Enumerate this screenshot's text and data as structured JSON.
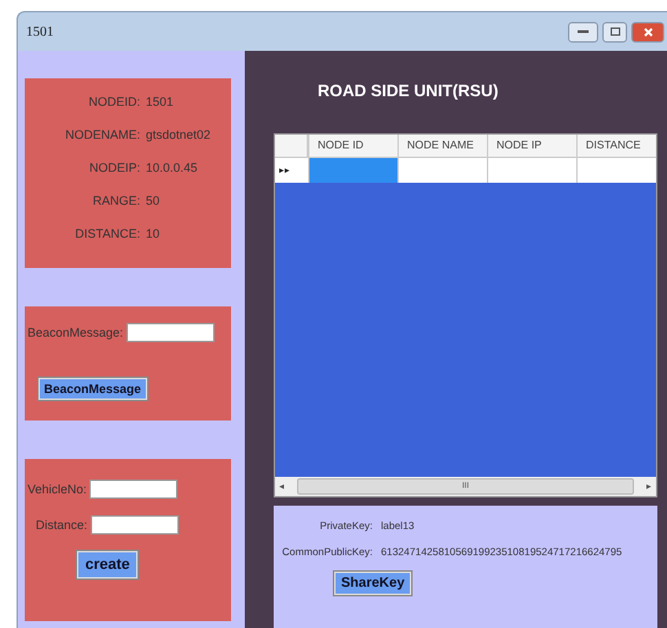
{
  "window": {
    "title": "1501"
  },
  "node_info": [
    {
      "label": "NODEID:",
      "value": "1501"
    },
    {
      "label": "NODENAME:",
      "value": "gtsdotnet02"
    },
    {
      "label": "NODEIP:",
      "value": "10.0.0.45"
    },
    {
      "label": "RANGE:",
      "value": "50"
    },
    {
      "label": "DISTANCE:",
      "value": "10"
    }
  ],
  "beacon": {
    "label": "BeaconMessage:",
    "button": "BeaconMessage"
  },
  "vehicle": {
    "fields": [
      {
        "label": "VehicleNo:"
      },
      {
        "label": "Distance:"
      }
    ],
    "button": "create"
  },
  "rsu": {
    "title": "ROAD SIDE UNIT(RSU)",
    "row_marker": "▸▸",
    "columns": [
      "NODE ID",
      "NODE NAME",
      "NODE IP",
      "DISTANCE"
    ],
    "row_cells": [
      {
        "selected": true
      },
      {
        "selected": false
      },
      {
        "selected": false
      },
      {
        "selected": false
      }
    ],
    "scroll": {
      "left": "◂",
      "thumb": "III",
      "right": "▸"
    }
  },
  "keys": {
    "private_label": "PrivateKey:",
    "private_value": "label13",
    "public_label": "CommonPublicKey:",
    "public_value": "613247142581056919923510819524717216624795",
    "button": "ShareKey"
  }
}
